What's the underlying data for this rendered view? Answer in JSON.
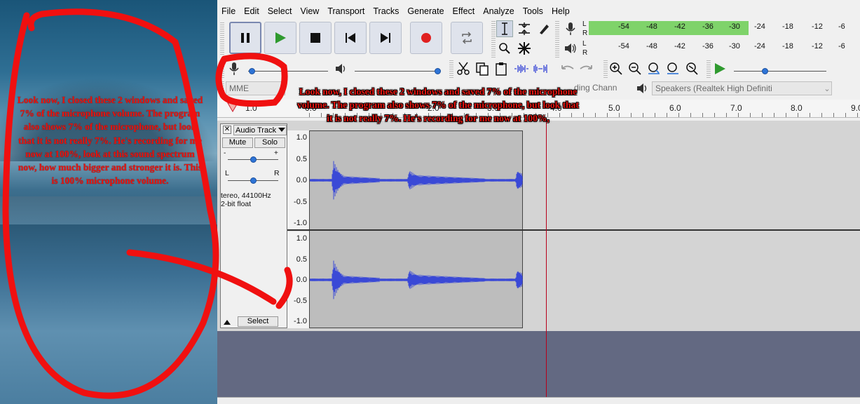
{
  "left_annotation": "Look now, I closed these 2 windows and saved 7% of the microphone volume. The program also shows 7% of the microphone, but look that it is not really 7%. He's recording for me now at 100%, look at this sound spectrum now, how much bigger and stronger it is. This is 100% microphone volume.",
  "center_annotation": "Look now, I closed these 2 windows and saved 7% of the microphone volume. The program also shows 7% of the microphone, but look that it is not really 7%. He's recording for me now at 100%,",
  "menu": [
    "File",
    "Edit",
    "Select",
    "View",
    "Transport",
    "Tracks",
    "Generate",
    "Effect",
    "Analyze",
    "Tools",
    "Help"
  ],
  "meter": {
    "ticks": [
      "-54",
      "-48",
      "-42",
      "-36",
      "-30",
      "-24",
      "-18",
      "-12",
      "-6"
    ],
    "record_level": 0.62,
    "L": "L",
    "R": "R"
  },
  "devices": {
    "host": "MME",
    "channels": "ding Chann",
    "playback": "Speakers (Realtek High Definiti"
  },
  "ruler": [
    "1.0",
    "0.0",
    "2.0",
    "3.0",
    "4.0",
    "5.0",
    "6.0",
    "7.0",
    "8.0",
    "9.0"
  ],
  "track": {
    "close": "✕",
    "name": "Audio Track",
    "mute": "Mute",
    "solo": "Solo",
    "info1": "tereo, 44100Hz",
    "info2": "2-bit float",
    "select": "Select",
    "pan_L": "L",
    "pan_R": "R",
    "gain_minus": "-",
    "gain_plus": "+"
  },
  "scale": [
    "1.0",
    "0.5",
    "0.0",
    "-0.5",
    "-1.0"
  ],
  "colors": {
    "wave": "#3a49d6",
    "annotation": "#e8140f",
    "cursor": "#b8001a",
    "meter_green": "#7fd36a"
  }
}
